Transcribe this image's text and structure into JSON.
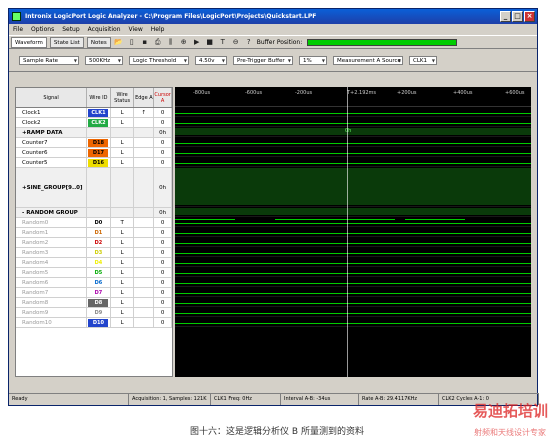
{
  "window": {
    "title": "Intronix LogicPort Logic Analyzer - C:\\Program Files\\LogicPort\\Projects\\Quickstart.LPF"
  },
  "menu": [
    "File",
    "Options",
    "Setup",
    "Acquisition",
    "View",
    "Help"
  ],
  "toolbar": {
    "tabs": [
      "Waveform",
      "State List",
      "Notes"
    ],
    "buffer_label": "Buffer Position:"
  },
  "controls": {
    "sample_rate_label": "Sample Rate",
    "sample_rate_value": "500KHz",
    "threshold_label": "Logic Threshold",
    "threshold_value": "4.50v",
    "pretrigger_label": "Pre-Trigger Buffer",
    "pretrigger_value": "1%",
    "measure_label": "Measurement A Source",
    "measure_value": "CLK1"
  },
  "table": {
    "headers": [
      "Signal",
      "Wire ID",
      "Wire Status",
      "Edge A",
      "Cursor A"
    ],
    "rows": [
      {
        "signal": "Clock1",
        "wire": "CLK1",
        "status": "L",
        "edge": "↑",
        "cursor": "0",
        "wcolor": "#2244cc",
        "tcolor": "#fff"
      },
      {
        "signal": "Clock2",
        "wire": "CLK2",
        "status": "L",
        "edge": "",
        "cursor": "0",
        "wcolor": "#22aa44",
        "tcolor": "#fff"
      },
      {
        "signal": "+RAMP DATA",
        "wire": "",
        "status": "",
        "edge": "",
        "cursor": "0h",
        "group": true
      },
      {
        "signal": "Counter7",
        "wire": "D18",
        "status": "L",
        "edge": "",
        "cursor": "0",
        "wcolor": "#ee6600",
        "tcolor": "#000"
      },
      {
        "signal": "Counter6",
        "wire": "D17",
        "status": "L",
        "edge": "",
        "cursor": "0",
        "wcolor": "#ee6600",
        "tcolor": "#000"
      },
      {
        "signal": "Counter5",
        "wire": "D16",
        "status": "L",
        "edge": "",
        "cursor": "0",
        "wcolor": "#eedd00",
        "tcolor": "#000"
      },
      {
        "signal": "+SINE_GROUP[9..0]",
        "wire": "",
        "status": "",
        "edge": "",
        "cursor": "0h",
        "group": true,
        "tall": true
      },
      {
        "signal": "- RANDOM GROUP",
        "wire": "",
        "status": "",
        "edge": "",
        "cursor": "0h",
        "group": true
      },
      {
        "signal": "Random0",
        "wire": "D0",
        "status": "T",
        "edge": "",
        "cursor": "0",
        "wcolor": "#fff",
        "tcolor": "#000",
        "dim": true
      },
      {
        "signal": "Random1",
        "wire": "D1",
        "status": "L",
        "edge": "",
        "cursor": "0",
        "wcolor": "#fff",
        "tcolor": "#c60",
        "dim": true
      },
      {
        "signal": "Random2",
        "wire": "D2",
        "status": "L",
        "edge": "",
        "cursor": "0",
        "wcolor": "#fff",
        "tcolor": "#c00",
        "dim": true
      },
      {
        "signal": "Random3",
        "wire": "D3",
        "status": "L",
        "edge": "",
        "cursor": "0",
        "wcolor": "#fff",
        "tcolor": "#cc0",
        "dim": true
      },
      {
        "signal": "Random4",
        "wire": "D4",
        "status": "L",
        "edge": "",
        "cursor": "0",
        "wcolor": "#fff",
        "tcolor": "#ee0",
        "dim": true
      },
      {
        "signal": "Random5",
        "wire": "D5",
        "status": "L",
        "edge": "",
        "cursor": "0",
        "wcolor": "#fff",
        "tcolor": "#0a0",
        "dim": true
      },
      {
        "signal": "Random6",
        "wire": "D6",
        "status": "L",
        "edge": "",
        "cursor": "0",
        "wcolor": "#fff",
        "tcolor": "#06c",
        "dim": true
      },
      {
        "signal": "Random7",
        "wire": "D7",
        "status": "L",
        "edge": "",
        "cursor": "0",
        "wcolor": "#fff",
        "tcolor": "#a0a",
        "dim": true
      },
      {
        "signal": "Random8",
        "wire": "D8",
        "status": "L",
        "edge": "",
        "cursor": "0",
        "wcolor": "#666",
        "tcolor": "#fff",
        "dim": true
      },
      {
        "signal": "Random9",
        "wire": "D9",
        "status": "L",
        "edge": "",
        "cursor": "0",
        "wcolor": "#fff",
        "tcolor": "#888",
        "dim": true
      },
      {
        "signal": "Random10",
        "wire": "D10",
        "status": "L",
        "edge": "",
        "cursor": "0",
        "wcolor": "#2244cc",
        "tcolor": "#fff",
        "dim": true
      }
    ]
  },
  "ruler": [
    "-800us",
    "-600us",
    "-200us",
    "T+2.192ms",
    "+200us",
    "+400us",
    "+600us"
  ],
  "ramp_label": "0h",
  "status": [
    "Ready",
    "Acquisition: 1, Samples: 121K",
    "CLK1 Freq: 0Hz",
    "Interval A-B: -34us",
    "Rate A-B: 29.4117KHz",
    "CLK2 Cycles A-1: 0"
  ],
  "caption": "图十六：这是逻辑分析仪 B 所量测到的资料",
  "watermark": "易迪拓培训",
  "watermark_sub": "射频和天线设计专家"
}
